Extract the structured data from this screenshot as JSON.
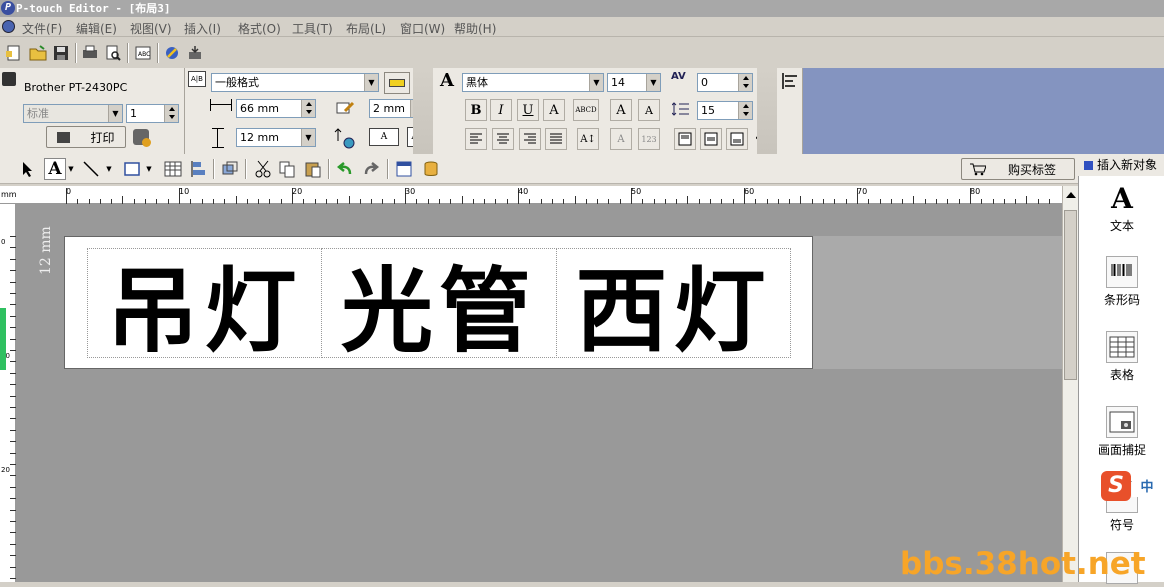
{
  "window": {
    "title": "P-touch Editor - [布局3]"
  },
  "menu": [
    "文件(F)",
    "编辑(E)",
    "视图(V)",
    "插入(I)",
    "格式(O)",
    "工具(T)",
    "布局(L)",
    "窗口(W)",
    "帮助(H)"
  ],
  "printer": {
    "name": "Brother PT-2430PC",
    "mode": "标准",
    "copies": "1",
    "print_label": "打印"
  },
  "layout": {
    "format": "一般格式",
    "length": "66 mm",
    "margin": "2 mm",
    "height": "12 mm"
  },
  "font": {
    "family": "黑体",
    "size": "14",
    "char_spacing": "0",
    "line_spacing": "15"
  },
  "toolbar2": {
    "buy_label": "购买标签"
  },
  "insert_panel": {
    "header": "插入新对象",
    "items": [
      "文本",
      "条形码",
      "表格",
      "画面捕捉",
      "符号"
    ]
  },
  "ruler": {
    "h_labels": [
      "0",
      "10",
      "20",
      "30",
      "40",
      "50",
      "60",
      "70",
      "80"
    ],
    "v_labels": [
      "0",
      "10",
      "20"
    ],
    "unit": "mm"
  },
  "label": {
    "tape_width": "12 mm",
    "cells": [
      "吊灯",
      "光管",
      "西灯"
    ]
  },
  "ime": {
    "badge": "中",
    "logo": "S"
  },
  "watermark": "bbs.38hot.net"
}
